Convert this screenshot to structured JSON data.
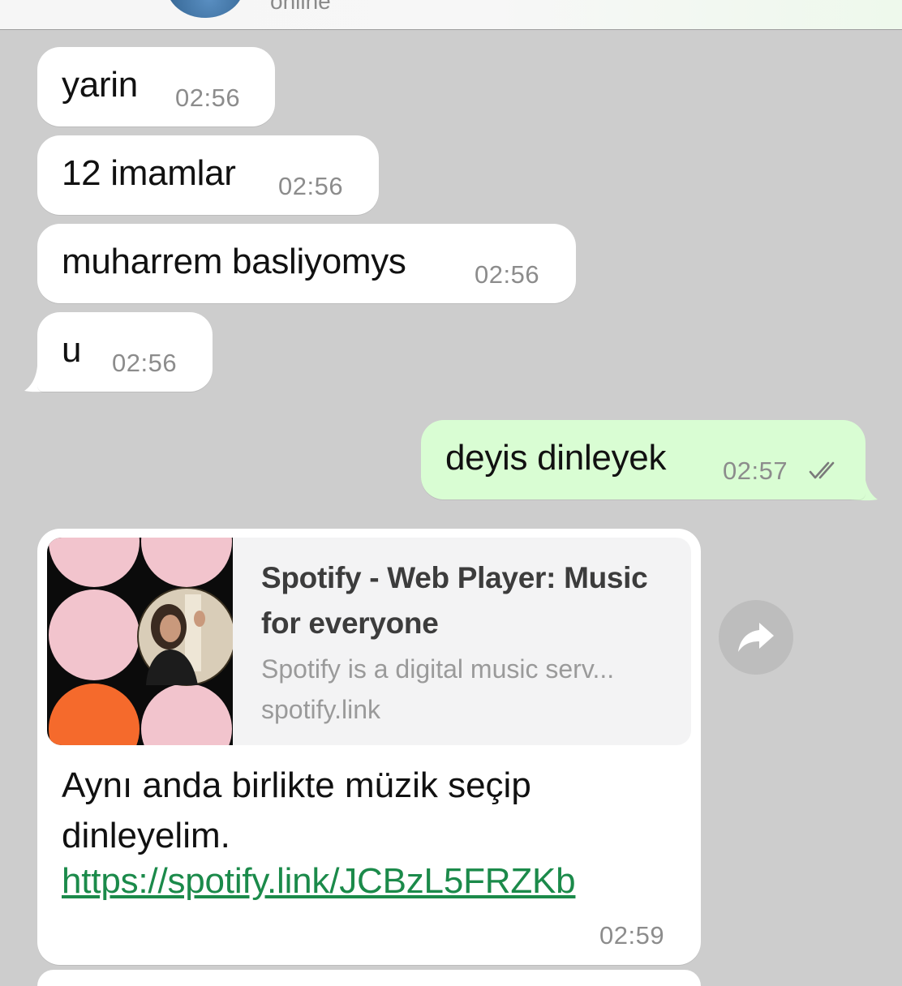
{
  "header": {
    "contact_status": "online"
  },
  "messages": [
    {
      "direction": "incoming",
      "text": "yarin",
      "time": "02:56"
    },
    {
      "direction": "incoming",
      "text": "12 imamlar",
      "time": "02:56"
    },
    {
      "direction": "incoming",
      "text": "muharrem basliyomys",
      "time": "02:56"
    },
    {
      "direction": "incoming",
      "text": "u",
      "time": "02:56"
    },
    {
      "direction": "outgoing",
      "text": "deyis dinleyek",
      "time": "02:57",
      "read_receipt": "double-check-icon"
    }
  ],
  "link_message": {
    "preview_title": "Spotify - Web Player: Music for everyone",
    "preview_description": "Spotify is a digital music serv...",
    "preview_domain": "spotify.link",
    "text": "Aynı anda birlikte müzik seçip dinleyelim.",
    "url": "https://spotify.link/JCBzL5FRZKb",
    "time": "02:59"
  },
  "colors": {
    "chat_background": "#cdcdcd",
    "incoming_bubble": "#ffffff",
    "outgoing_bubble": "#d9fdd3",
    "link": "#1b8a4a",
    "timestamp": "#8c8c8c"
  }
}
